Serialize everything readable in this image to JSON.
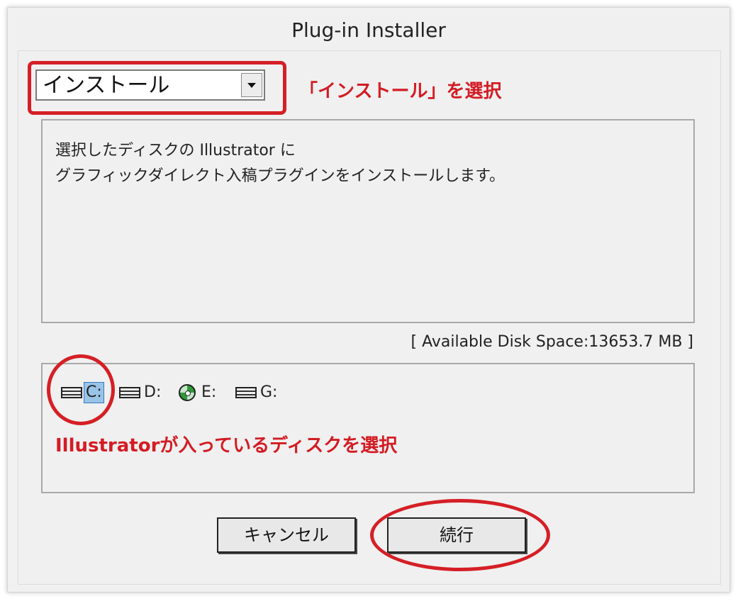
{
  "window": {
    "title": "Plug-in Installer"
  },
  "mode_select": {
    "selected": "インストール",
    "icon": "chevron-down-icon"
  },
  "description": {
    "line1": "選択したディスクの Illustrator に",
    "line2": "グラフィックダイレクト入稿プラグインをインストールします。"
  },
  "disk_space": {
    "text": "[ Available Disk Space:13653.7 MB ]"
  },
  "drives": [
    {
      "label": "C:",
      "icon": "hard-drive-icon",
      "selected": true
    },
    {
      "label": "D:",
      "icon": "hard-drive-icon",
      "selected": false
    },
    {
      "label": "E:",
      "icon": "optical-disc-icon",
      "selected": false
    },
    {
      "label": "G:",
      "icon": "hard-drive-icon",
      "selected": false
    }
  ],
  "buttons": {
    "cancel": "キャンセル",
    "continue": "続行"
  },
  "annotations": {
    "select_install": "「インストール」を選択",
    "select_disk": "Illustratorが入っているディスクを選択",
    "color": "#d51f26"
  },
  "colors": {
    "selection": "#99c4e8",
    "window_bg": "#f0f0f0"
  }
}
